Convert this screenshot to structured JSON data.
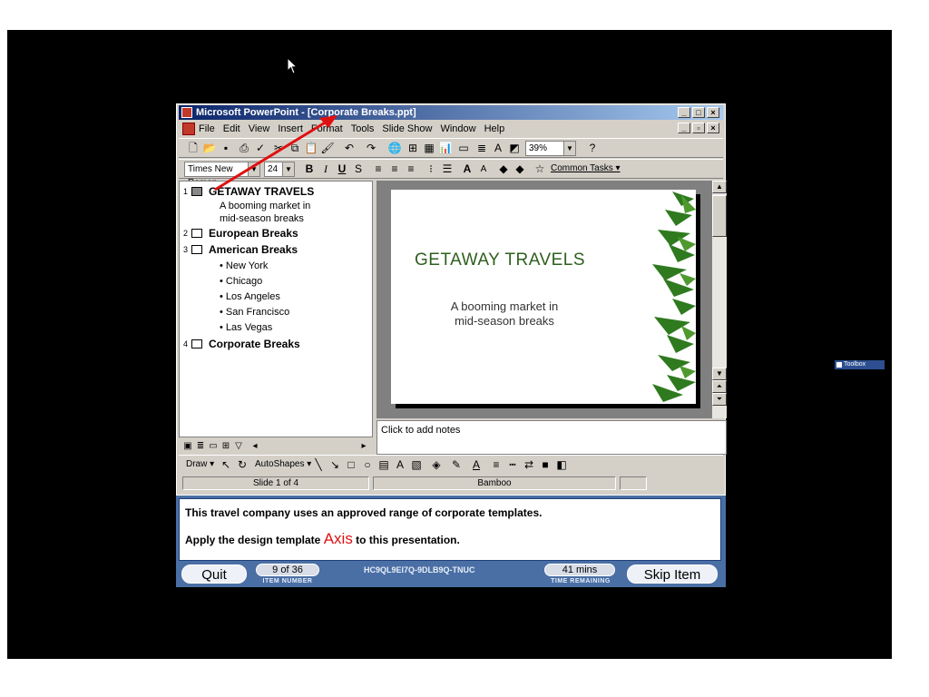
{
  "window": {
    "title": "Microsoft PowerPoint - [Corporate Breaks.ppt]"
  },
  "menu": [
    "File",
    "Edit",
    "View",
    "Insert",
    "Format",
    "Tools",
    "Slide Show",
    "Window",
    "Help"
  ],
  "formatting": {
    "font": "Times New Roman",
    "size": "24",
    "zoom": "39%",
    "common_tasks": "Common Tasks ▾"
  },
  "outline": {
    "slides": [
      {
        "num": "1",
        "title": "GETAWAY TRAVELS",
        "lines": [
          "A booming market in",
          "mid-season breaks"
        ]
      },
      {
        "num": "2",
        "title": "European Breaks",
        "lines": []
      },
      {
        "num": "3",
        "title": "American Breaks",
        "lines": [
          "• New York",
          "• Chicago",
          "• Los Angeles",
          "• San Francisco",
          "• Las Vegas"
        ]
      },
      {
        "num": "4",
        "title": "Corporate Breaks",
        "lines": []
      }
    ]
  },
  "slide": {
    "title": "GETAWAY TRAVELS",
    "subtitle_line1": "A booming market in",
    "subtitle_line2": "mid-season breaks"
  },
  "notes": {
    "placeholder": "Click to add notes"
  },
  "drawing": {
    "draw_label": "Draw ▾",
    "autoshapes_label": "AutoShapes ▾"
  },
  "status": {
    "slide_info": "Slide 1 of 4",
    "design": "Bamboo"
  },
  "exam": {
    "line1": "This travel company uses an approved range of corporate templates.",
    "line2_prefix": "Apply the design template",
    "line2_highlight": "Axis",
    "line2_suffix": "to this presentation.",
    "quit": "Quit",
    "item_number": "9 of 36",
    "item_number_label": "ITEM NUMBER",
    "code": "HC9QL9EI7Q-9DLB9Q-TNUC",
    "time_remaining": "41 mins",
    "time_remaining_label": "TIME REMAINING",
    "skip": "Skip Item"
  },
  "desktop": {
    "toolbox_label": "Toolbox"
  },
  "colors": {
    "titlebar_start": "#0a246a",
    "exam_frame": "#4a6fa5",
    "annotation_arrow": "#e01010",
    "slide_title": "#2f5f1e"
  }
}
